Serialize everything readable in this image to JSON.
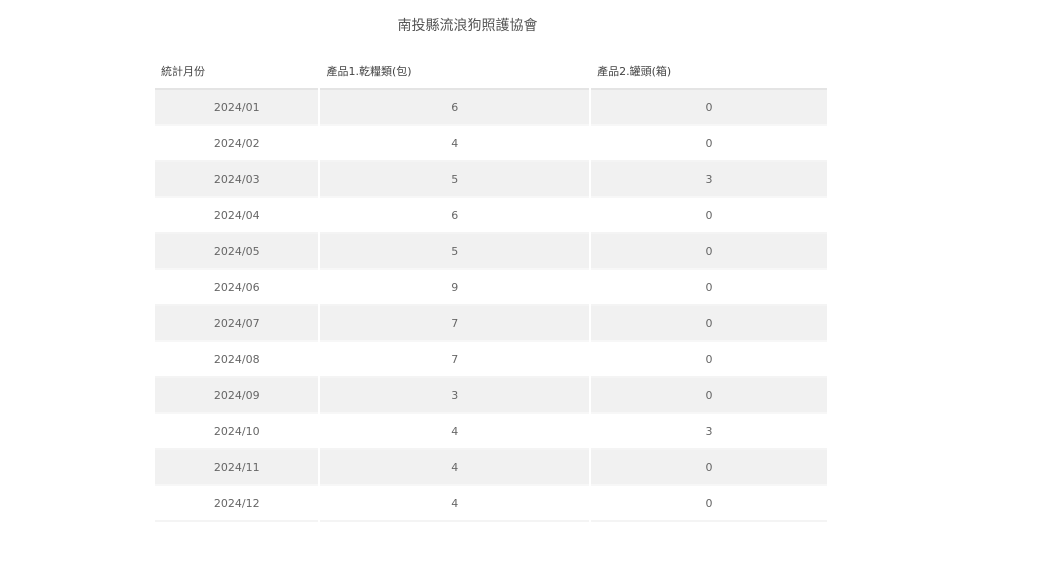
{
  "title": "南投縣流浪狗照護協會",
  "table": {
    "headers": [
      "統計月份",
      "產品1.乾糧類(包)",
      "產品2.罐頭(箱)"
    ],
    "rows": [
      [
        "2024/01",
        "6",
        "0"
      ],
      [
        "2024/02",
        "4",
        "0"
      ],
      [
        "2024/03",
        "5",
        "3"
      ],
      [
        "2024/04",
        "6",
        "0"
      ],
      [
        "2024/05",
        "5",
        "0"
      ],
      [
        "2024/06",
        "9",
        "0"
      ],
      [
        "2024/07",
        "7",
        "0"
      ],
      [
        "2024/08",
        "7",
        "0"
      ],
      [
        "2024/09",
        "3",
        "0"
      ],
      [
        "2024/10",
        "4",
        "3"
      ],
      [
        "2024/11",
        "4",
        "0"
      ],
      [
        "2024/12",
        "4",
        "0"
      ]
    ]
  }
}
